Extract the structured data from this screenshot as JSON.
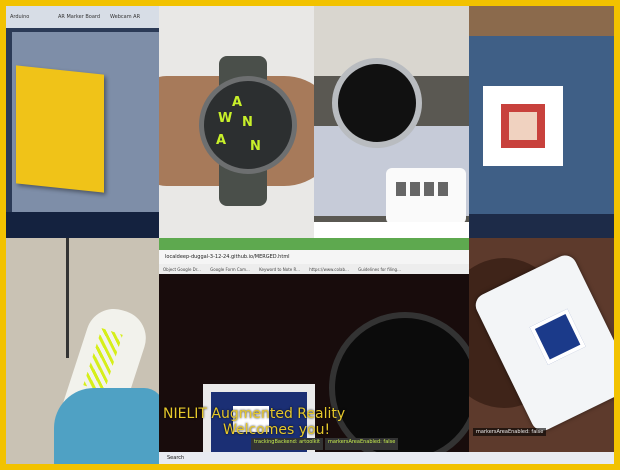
{
  "tile1": {
    "tabs": [
      "Arduino",
      "AR Marker Board",
      "Webcam AR"
    ]
  },
  "tile2": {
    "watch_face_text": [
      "W",
      "A",
      "N",
      "A",
      "N"
    ]
  },
  "tile6": {
    "url": "localdeep-duggal-3-12-24.github.io/MERGED.html",
    "bookmarks": [
      "Object Google Dr...",
      "Google Form Cam...",
      "Keyword to Note R...",
      "https://www.colab...",
      "Guidelines for filing..."
    ],
    "overlay_lines": [
      "NIELIT Augmented Reality",
      "Welcomes you!"
    ],
    "status_left": "trackingBackend: artoolkit",
    "status_right": "markersAreaEnabled: false",
    "taskbar_search": "Search"
  },
  "tile7": {
    "status": "markersAreaEnabled: false"
  },
  "colors": {
    "border": "#f2c200",
    "paper": "#f0c318",
    "ar_text": "#e6c82b",
    "lace": "#d6ef1a"
  }
}
